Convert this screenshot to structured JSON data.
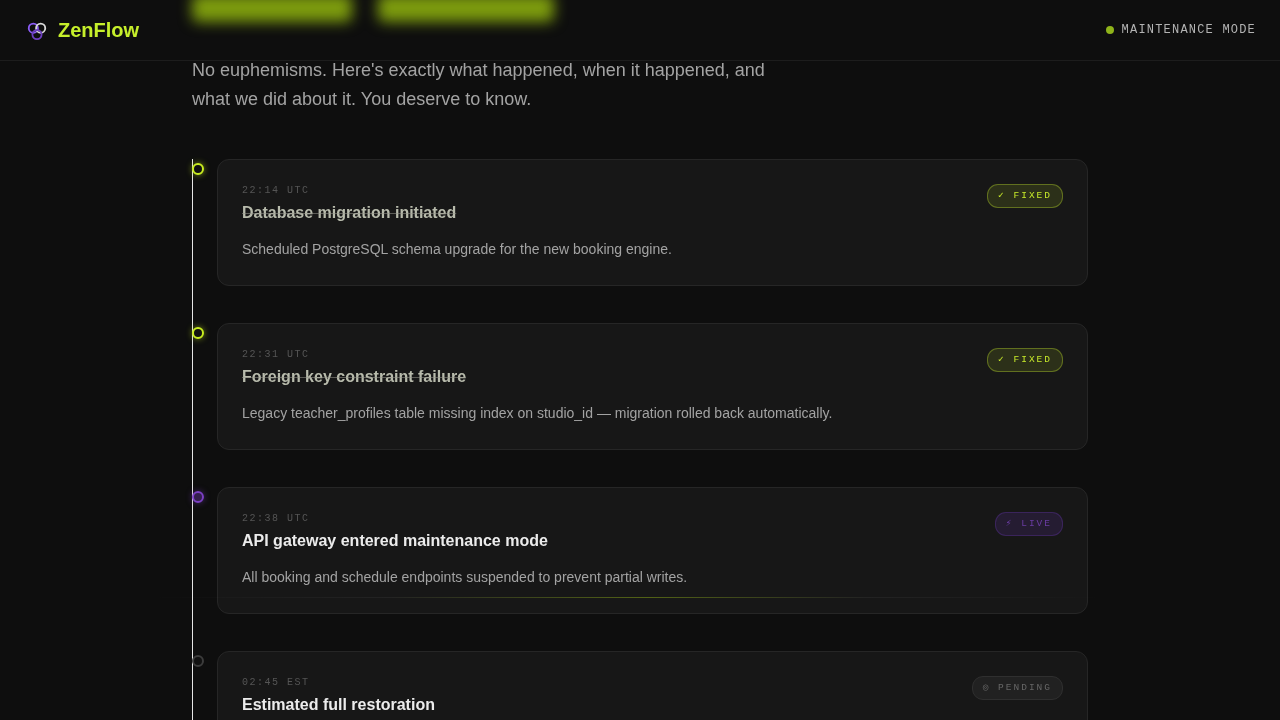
{
  "header": {
    "brand": "ZenFlow",
    "status_label": "MAINTENANCE MODE"
  },
  "intro": "No euphemisms. Here's exactly what happened, when it happened, and what we did about it. You deserve to know.",
  "timeline": [
    {
      "time": "22:14 UTC",
      "title": "Database migration initiated",
      "description": "Scheduled PostgreSQL schema upgrade for the new booking engine.",
      "kind": "fixed",
      "badge": "✓ FIXED"
    },
    {
      "time": "22:31 UTC",
      "title": "Foreign key constraint failure",
      "description": "Legacy teacher_profiles table missing index on studio_id — migration rolled back automatically.",
      "kind": "fixed",
      "badge": "✓ FIXED"
    },
    {
      "time": "22:38 UTC",
      "title": "API gateway entered maintenance mode",
      "description": "All booking and schedule endpoints suspended to prevent partial writes.",
      "kind": "live",
      "badge": "⚡ LIVE"
    },
    {
      "time": "02:45 EST",
      "title": "Estimated full restoration",
      "kind": "pending",
      "badge": "◎ PENDING"
    }
  ]
}
